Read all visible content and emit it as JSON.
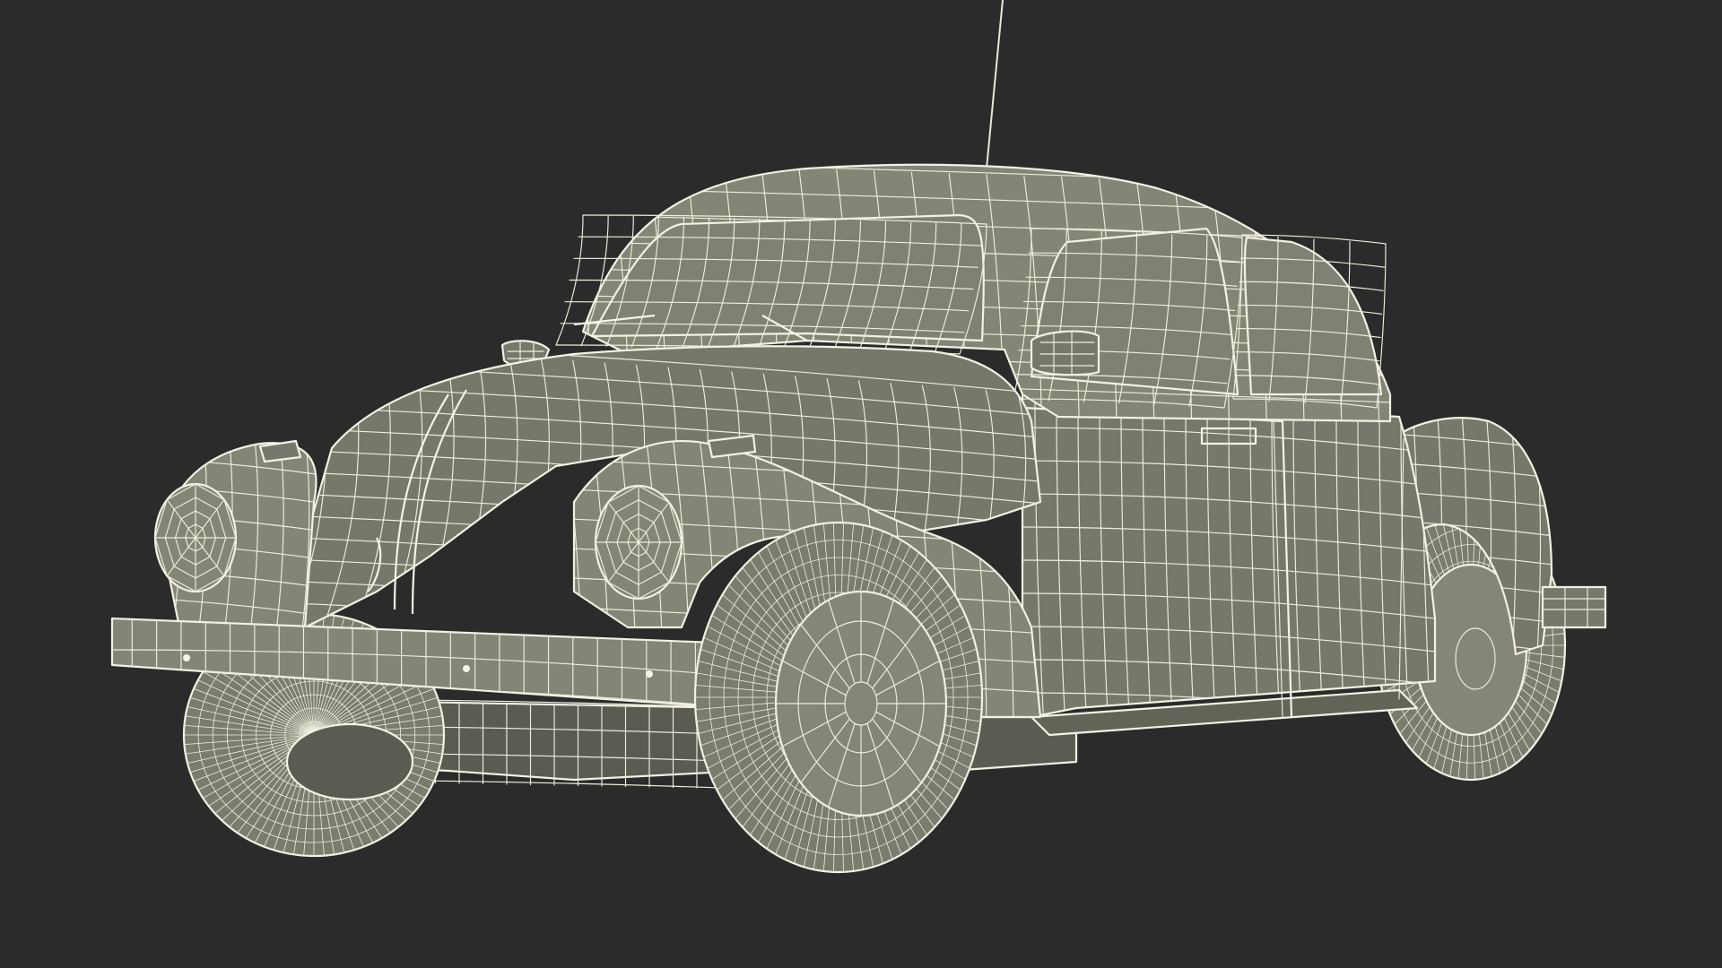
{
  "scene": {
    "subject_icon": "wireframe-car-icon",
    "colors": {
      "background": "#2b2b2b",
      "body_fill": "#77786b",
      "body_fill_light": "#848576",
      "body_fill_dark": "#636458",
      "glass_fill": "#808174",
      "tire_fill": "#7b7c70",
      "hub_fill": "#85867a",
      "underbody_fill": "#5a5b51",
      "wire": "#eeeedd"
    }
  }
}
